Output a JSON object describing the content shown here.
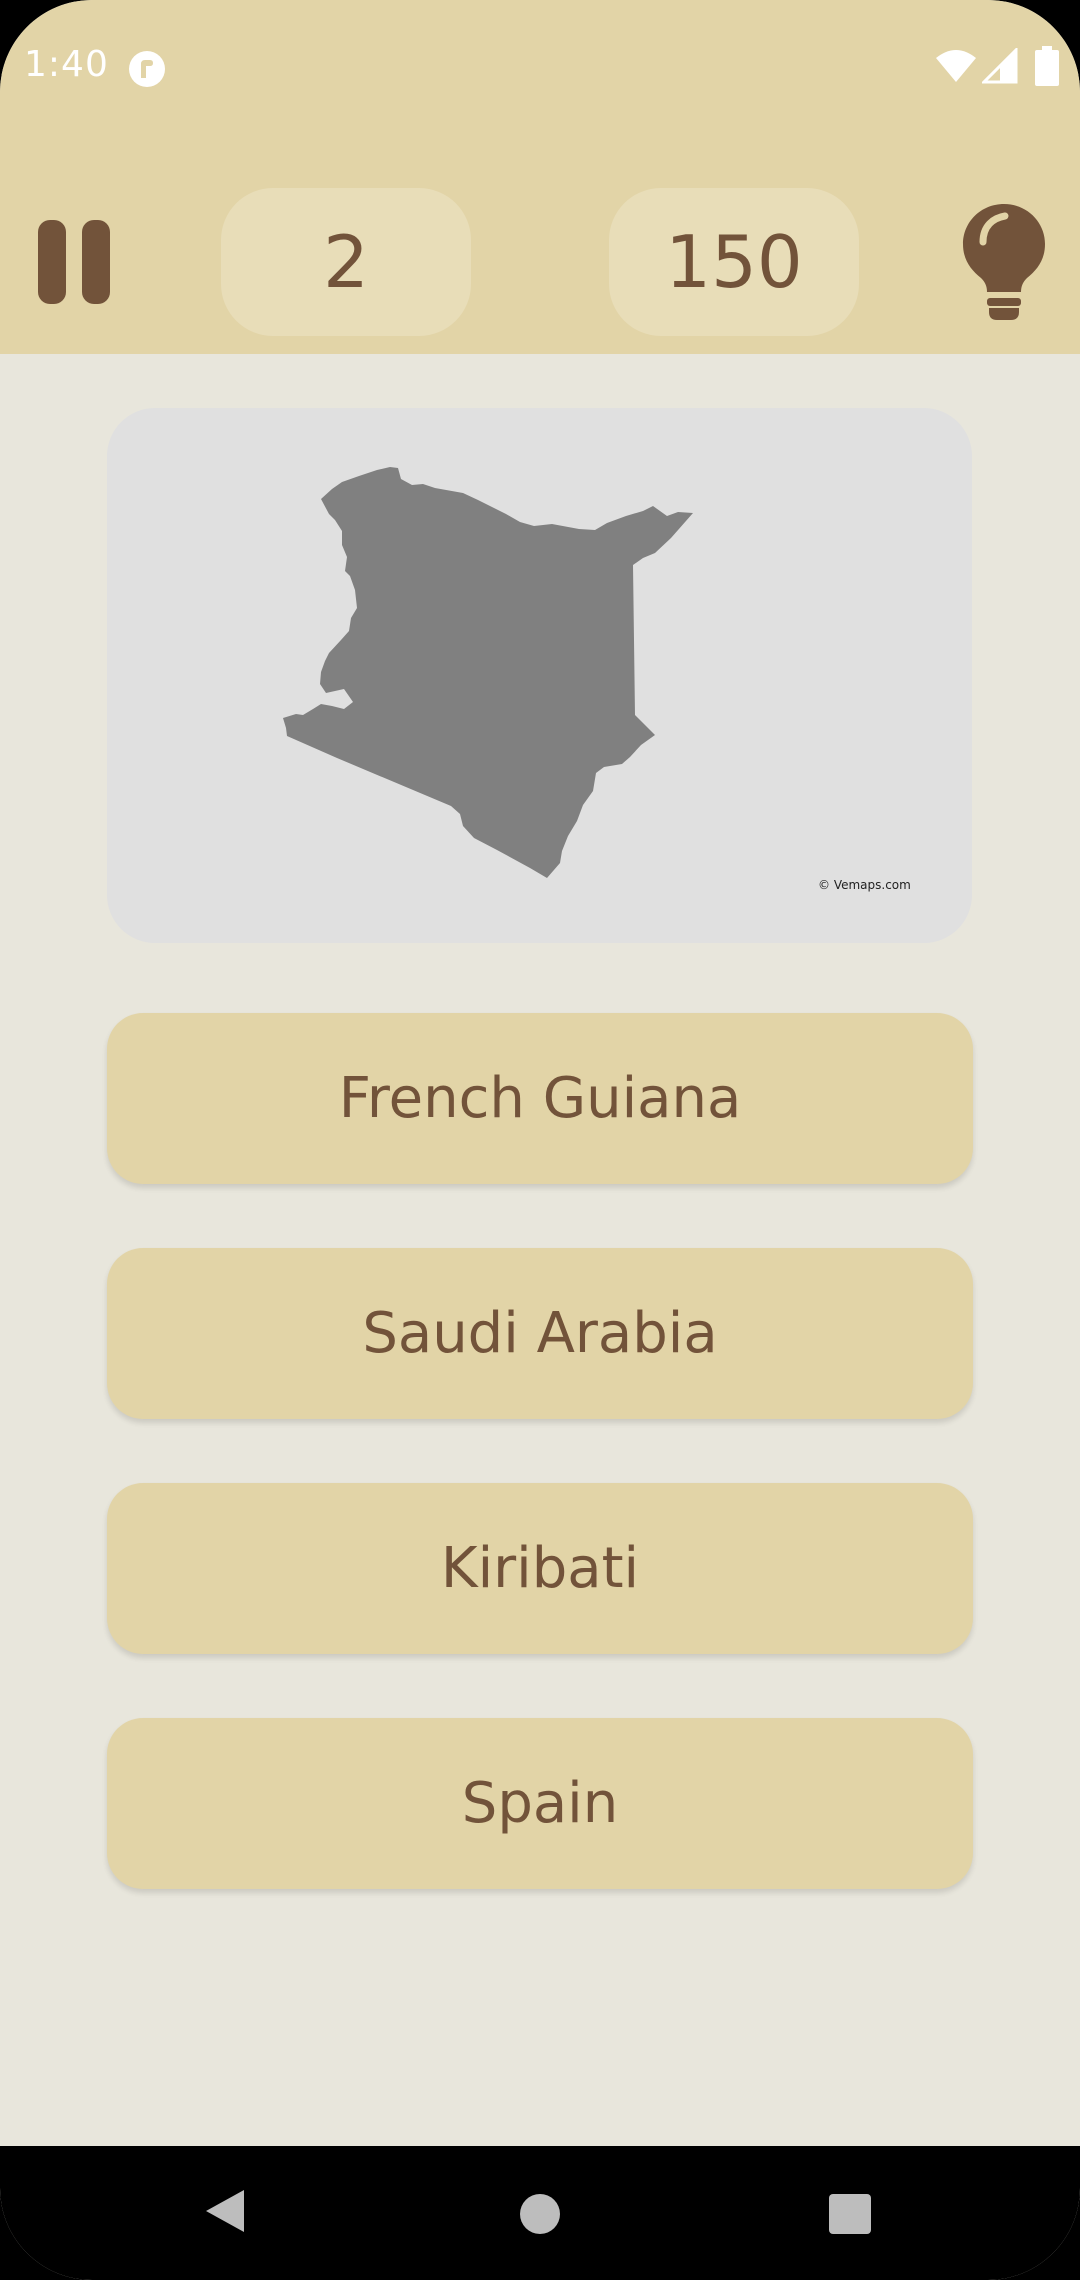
{
  "status_bar": {
    "time": "1:40",
    "app_icon": "r-circle-icon",
    "icons": [
      "wifi-icon",
      "cell-signal-icon",
      "battery-icon"
    ]
  },
  "toolbar": {
    "pause_icon": "pause-icon",
    "level": "2",
    "score": "150",
    "hint_icon": "lightbulb-icon"
  },
  "map": {
    "country_shape": "kenya-silhouette",
    "credit": "© Vemaps.com"
  },
  "answers": [
    {
      "label": "French Guiana"
    },
    {
      "label": "Saudi Arabia"
    },
    {
      "label": "Kiribati"
    },
    {
      "label": "Spain"
    }
  ],
  "nav_bar": {
    "icons": [
      "back-icon",
      "home-icon",
      "recents-icon"
    ]
  },
  "colors": {
    "header_background": "#e2d4a7",
    "pill_background": "#e8ddb8",
    "accent_brown": "#72533a",
    "screen_background": "#e8e6dc",
    "map_card_background": "#e0e0e0",
    "map_fill": "#808080"
  }
}
